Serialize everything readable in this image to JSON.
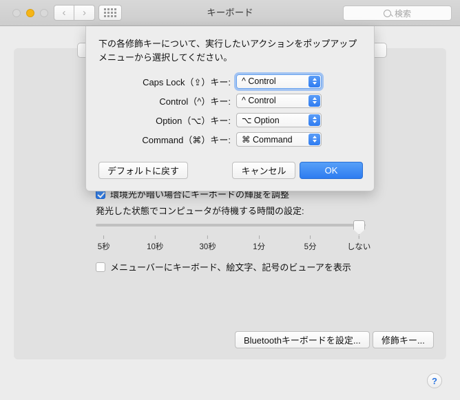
{
  "window": {
    "title": "キーボード",
    "traffic_lights": [
      "close",
      "minimize",
      "zoom"
    ],
    "nav_back_label": "‹",
    "nav_forward_label": "›",
    "show_all_icon": "grid-icon"
  },
  "search": {
    "placeholder": "検索",
    "value": "",
    "icon": "search-icon"
  },
  "background": {
    "ambient_checkbox": {
      "label": "環境光が暗い場合にキーボードの輝度を調整",
      "checked": true
    },
    "slider_label": "発光した状態でコンピュータが待機する時間の設定:",
    "slider": {
      "ticks": [
        "5秒",
        "10秒",
        "30秒",
        "1分",
        "5分",
        "しない"
      ],
      "value_label": "しない",
      "thumb_percent": 96
    },
    "viewer_checkbox": {
      "label": "メニューバーにキーボード、絵文字、記号のビューアを表示",
      "checked": false
    },
    "bluetooth_button": "Bluetoothキーボードを設定...",
    "modifier_button": "修飾キー...",
    "help_button": "?"
  },
  "sheet": {
    "description": "下の各修飾キーについて、実行したいアクションをポップアップメニューから選択してください。",
    "rows": [
      {
        "label": "Caps Lock（⇪）キー:",
        "value": "^ Control",
        "focused": true
      },
      {
        "label": "Control（^）キー:",
        "value": "^ Control",
        "focused": false
      },
      {
        "label": "Option（⌥）キー:",
        "value": "⌥ Option",
        "focused": false
      },
      {
        "label": "Command（⌘）キー:",
        "value": "⌘ Command",
        "focused": false
      }
    ],
    "restore_defaults_label": "デフォルトに戻す",
    "cancel_label": "キャンセル",
    "ok_label": "OK"
  },
  "colors": {
    "accent_blue": "#2e7cf0",
    "toolbar_gray": "#d2d2d2",
    "panel_gray": "#e1e1e1",
    "sheet_gray": "#ededed",
    "minimize_yellow": "#f6b517",
    "help_blue": "#2a74e0"
  }
}
